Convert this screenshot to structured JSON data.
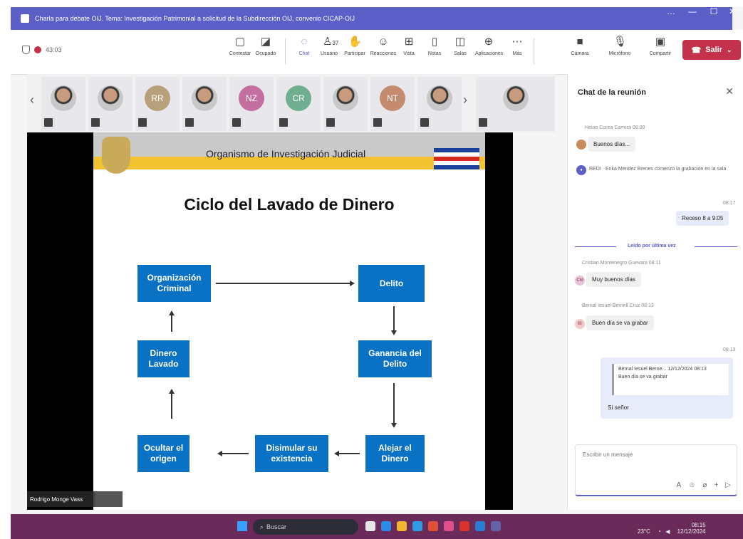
{
  "window": {
    "title": "Charla para debate OIJ. Tema: Investigación Patrimonial a solicitud de la Subdirección OIJ, convenio CICAP-OIJ",
    "controls": [
      "…",
      "—",
      "☐",
      "✕"
    ]
  },
  "toolbar": {
    "meeting_time": "43:03",
    "buttons": [
      {
        "label": "Contestar",
        "icon": "captions-icon"
      },
      {
        "label": "Ocupado",
        "icon": "copilot-icon"
      },
      {
        "label": "Chat",
        "icon": "chat-icon"
      },
      {
        "label": "Usuario",
        "icon": "people-icon"
      },
      {
        "label": "Participar",
        "icon": "raise-hand-icon"
      },
      {
        "label": "Reacciones",
        "icon": "reactions-icon"
      },
      {
        "label": "Vista",
        "icon": "view-icon"
      },
      {
        "label": "Notas",
        "icon": "notes-icon"
      },
      {
        "label": "Salas",
        "icon": "rooms-icon"
      },
      {
        "label": "Aplicaciones",
        "icon": "apps-icon"
      },
      {
        "label": "Más",
        "icon": "more-icon"
      }
    ],
    "camera_label": "Cámara",
    "mic_label": "Micrófono",
    "share_label": "Compartir",
    "leave_label": "Salir",
    "people_count": "37"
  },
  "participants": [
    {
      "type": "photo"
    },
    {
      "type": "photo"
    },
    {
      "type": "initials",
      "text": "RR",
      "color": "#b8a07a"
    },
    {
      "type": "photo"
    },
    {
      "type": "initials",
      "text": "NZ",
      "color": "#c46f9f"
    },
    {
      "type": "initials",
      "text": "CR",
      "color": "#6fae8e"
    },
    {
      "type": "photo"
    },
    {
      "type": "initials",
      "text": "NT",
      "color": "#c48b6f"
    },
    {
      "type": "photo"
    },
    {
      "type": "photo"
    }
  ],
  "slide": {
    "organization": "Organismo de Investigación Judicial",
    "title": "Ciclo del Lavado de Dinero",
    "boxes": {
      "org_criminal": "Organización Criminal",
      "delito": "Delito",
      "ganancia": "Ganancia del Delito",
      "alejar": "Alejar el Dinero",
      "disimular": "Disimular su existencia",
      "ocultar": "Ocultar el origen",
      "dinero_lavado": "Dinero Lavado"
    },
    "flag_colors": [
      "#1a3f9a",
      "#ffffff",
      "#d52b1e",
      "#ffffff",
      "#1a3f9a"
    ]
  },
  "presenter_name": "Rodrigo Monge Vass",
  "chat": {
    "title": "Chat de la reunión",
    "messages": [
      {
        "meta": "Heine Corea Carrera  08:00",
        "text": "Buenos días..."
      },
      {
        "meta": "",
        "system": "REDI · Erika Mendez Brenes comenzó la grabación en la sala"
      },
      {
        "meta": "08:17",
        "text": "Receso 8 a 9:05",
        "mine": true
      },
      {
        "divider": "Leído por última vez"
      },
      {
        "meta": "Cristian Montenegro Guevara  08:11",
        "text": "Muy buenos días",
        "initials": "CM"
      },
      {
        "meta": "Bernal Iesuel Bernell Cruz  08:13",
        "text": "Buen día se va grabar",
        "initials": "BI"
      },
      {
        "meta": "08:13",
        "quote_author": "Bernal Iesuel Berne...  12/12/2024 08:13",
        "quote_text": "Buen día se va grabar",
        "text": "Sí señor",
        "mine": true
      }
    ],
    "compose_placeholder": "Escribir un mensaje"
  },
  "taskbar": {
    "search_placeholder": "Buscar",
    "time": "08:15",
    "date": "12/12/2024",
    "weather": "23°C"
  }
}
